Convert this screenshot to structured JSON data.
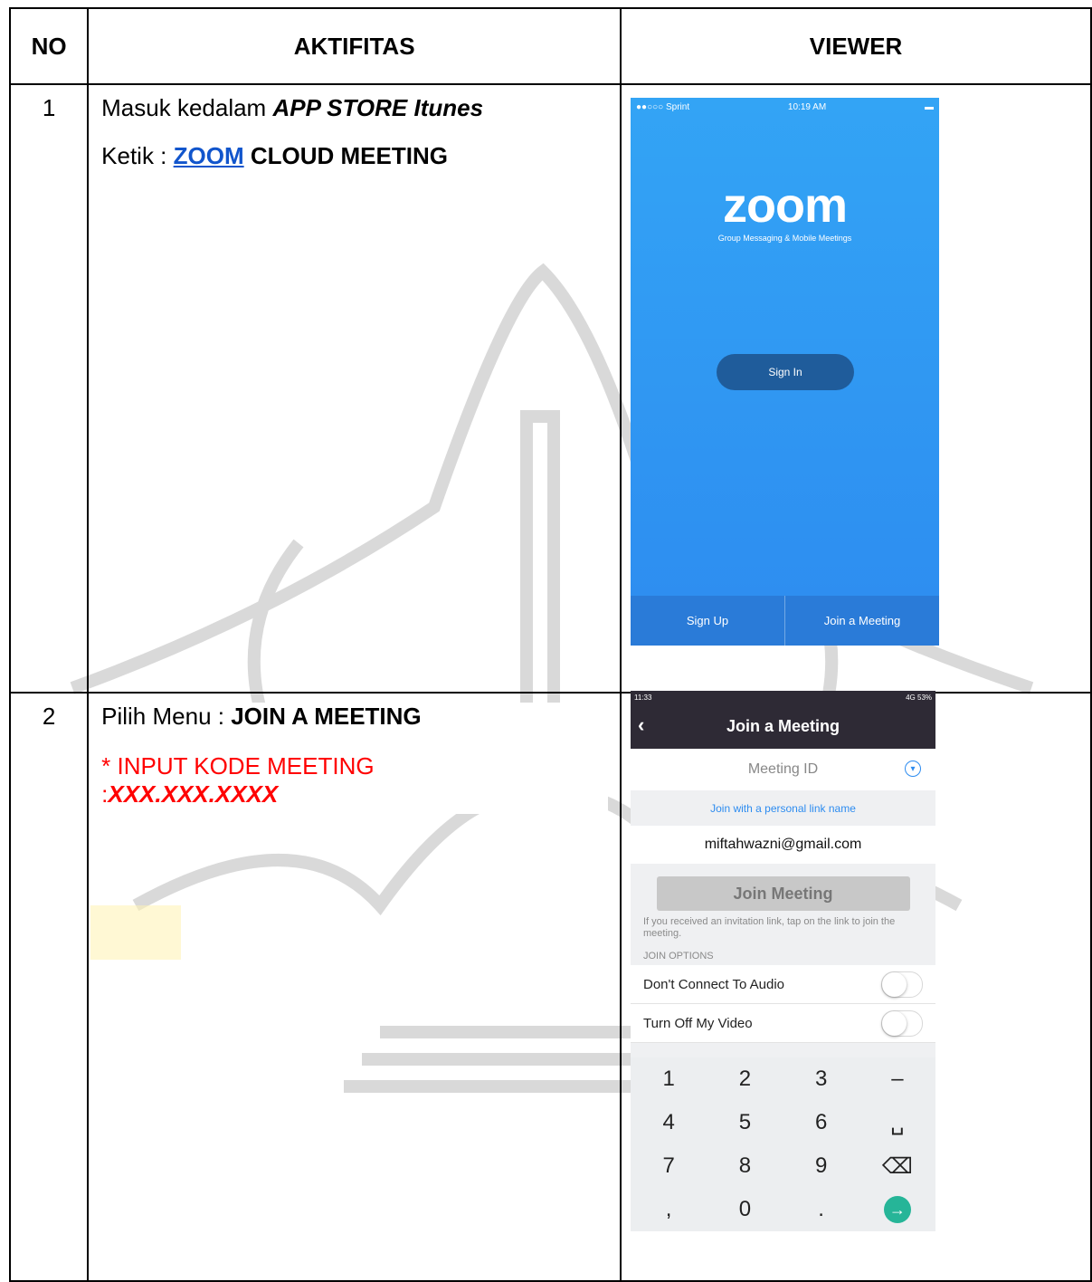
{
  "headers": {
    "no": "NO",
    "aktifitas": "AKTIFITAS",
    "viewer": "VIEWER"
  },
  "row1": {
    "no": "1",
    "line1_prefix": "Masuk kedalam ",
    "line1_bold": "APP STORE  Itunes",
    "line2_prefix": "Ketik : ",
    "line2_link": "ZOOM",
    "line2_rest": " CLOUD MEETING"
  },
  "row2": {
    "no": "2",
    "line1_prefix": "Pilih Menu : ",
    "line1_bold": "JOIN A MEETING",
    "line2": "* INPUT KODE MEETING",
    "line3_prefix": ":",
    "line3_bold": "XXX.XXX.XXXX"
  },
  "phone1": {
    "carrier": "●●○○○ Sprint",
    "time": "10:19 AM",
    "logo": "zoom",
    "tagline": "Group Messaging & Mobile Meetings",
    "sign_in": "Sign In",
    "sign_up": "Sign Up",
    "join": "Join a Meeting",
    "bg_color": "#2d8cf0"
  },
  "phone2": {
    "time": "11:33",
    "status_right": "4G 53%",
    "title": "Join a Meeting",
    "meeting_id_placeholder": "Meeting ID",
    "personal_link": "Join with a personal link name",
    "email": "miftahwazni@gmail.com",
    "join_button": "Join Meeting",
    "hint": "If you received an invitation link, tap on the link to join the meeting.",
    "options_header": "JOIN OPTIONS",
    "option1": "Don't Connect To Audio",
    "option2": "Turn Off My Video",
    "keys": [
      "1",
      "2",
      "3",
      "–",
      "4",
      "5",
      "6",
      "␣",
      "7",
      "8",
      "9",
      "⌫",
      ",",
      "0",
      ".",
      "→"
    ]
  }
}
